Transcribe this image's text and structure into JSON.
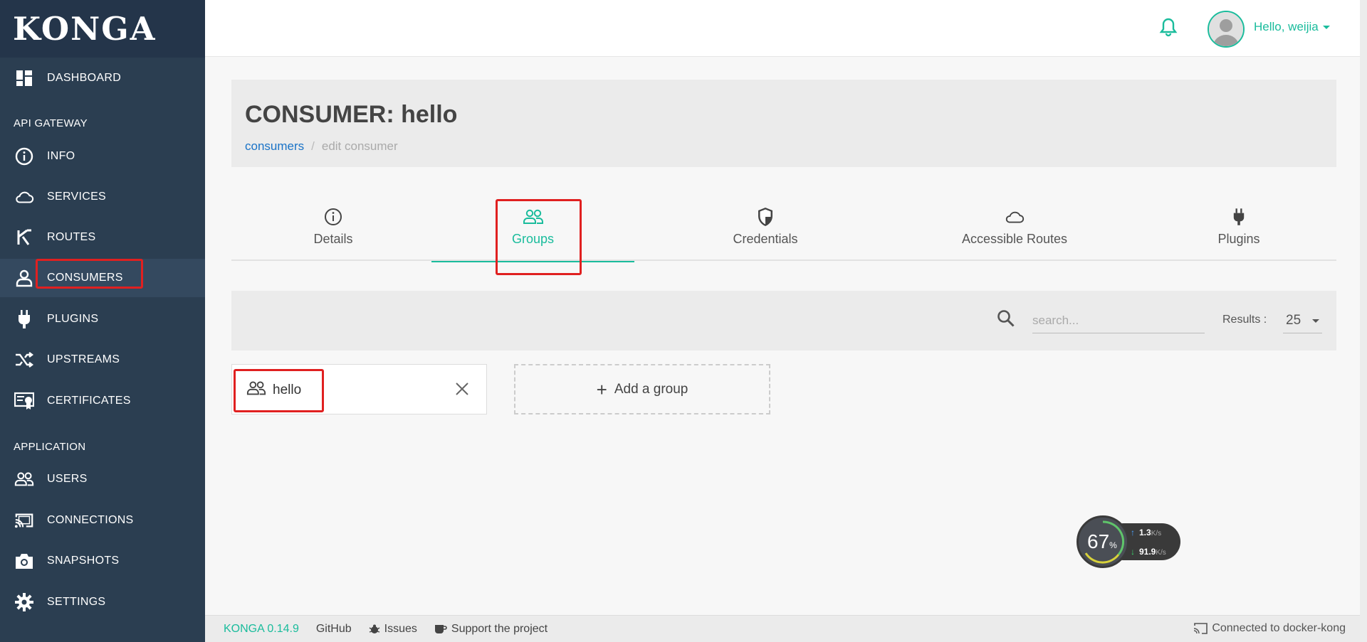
{
  "app": {
    "logo": "KONGA"
  },
  "sidebar": {
    "items": [
      {
        "key": "dashboard",
        "label": "DASHBOARD",
        "icon": "dashboard-icon"
      },
      {
        "key": "info",
        "label": "INFO",
        "icon": "info-icon"
      },
      {
        "key": "services",
        "label": "SERVICES",
        "icon": "cloud-icon"
      },
      {
        "key": "routes",
        "label": "ROUTES",
        "icon": "fork-icon"
      },
      {
        "key": "consumers",
        "label": "CONSUMERS",
        "icon": "user-icon"
      },
      {
        "key": "plugins",
        "label": "PLUGINS",
        "icon": "plug-icon"
      },
      {
        "key": "upstreams",
        "label": "UPSTREAMS",
        "icon": "shuffle-icon"
      },
      {
        "key": "certificates",
        "label": "CERTIFICATES",
        "icon": "certificate-icon"
      },
      {
        "key": "users",
        "label": "USERS",
        "icon": "users-icon"
      },
      {
        "key": "connections",
        "label": "CONNECTIONS",
        "icon": "cast-icon"
      },
      {
        "key": "snapshots",
        "label": "SNAPSHOTS",
        "icon": "camera-icon"
      },
      {
        "key": "settings",
        "label": "SETTINGS",
        "icon": "gear-icon"
      }
    ],
    "sections": {
      "api_gateway": "API GATEWAY",
      "application": "APPLICATION"
    },
    "active": "consumers"
  },
  "topbar": {
    "greeting": "Hello, weijia"
  },
  "header": {
    "title": "CONSUMER: hello",
    "breadcrumb": {
      "link": "consumers",
      "separator": "/",
      "current": "edit consumer"
    }
  },
  "tabs": [
    {
      "label": "Details",
      "icon": "info-icon"
    },
    {
      "label": "Groups",
      "icon": "users-icon"
    },
    {
      "label": "Credentials",
      "icon": "shield-icon"
    },
    {
      "label": "Accessible Routes",
      "icon": "cloud-icon"
    },
    {
      "label": "Plugins",
      "icon": "plug-icon"
    }
  ],
  "active_tab": "Groups",
  "toolbar": {
    "search_placeholder": "search...",
    "results_label": "Results :",
    "results_value": "25"
  },
  "groups": [
    {
      "name": "hello"
    }
  ],
  "add_group_label": "Add a group",
  "speed_widget": {
    "percent": "67",
    "percent_unit": "%",
    "up": "1.3",
    "up_unit": "K/s",
    "down": "91.9",
    "down_unit": "K/s"
  },
  "footer": {
    "brand": "KONGA 0.14.9",
    "github": "GitHub",
    "issues": "Issues",
    "support": "Support the project",
    "connection": "Connected to docker-kong"
  },
  "colors": {
    "accent": "#1abc9c",
    "sidebar": "#2b3e51",
    "highlight": "#e02020",
    "link": "#1a73c7"
  }
}
